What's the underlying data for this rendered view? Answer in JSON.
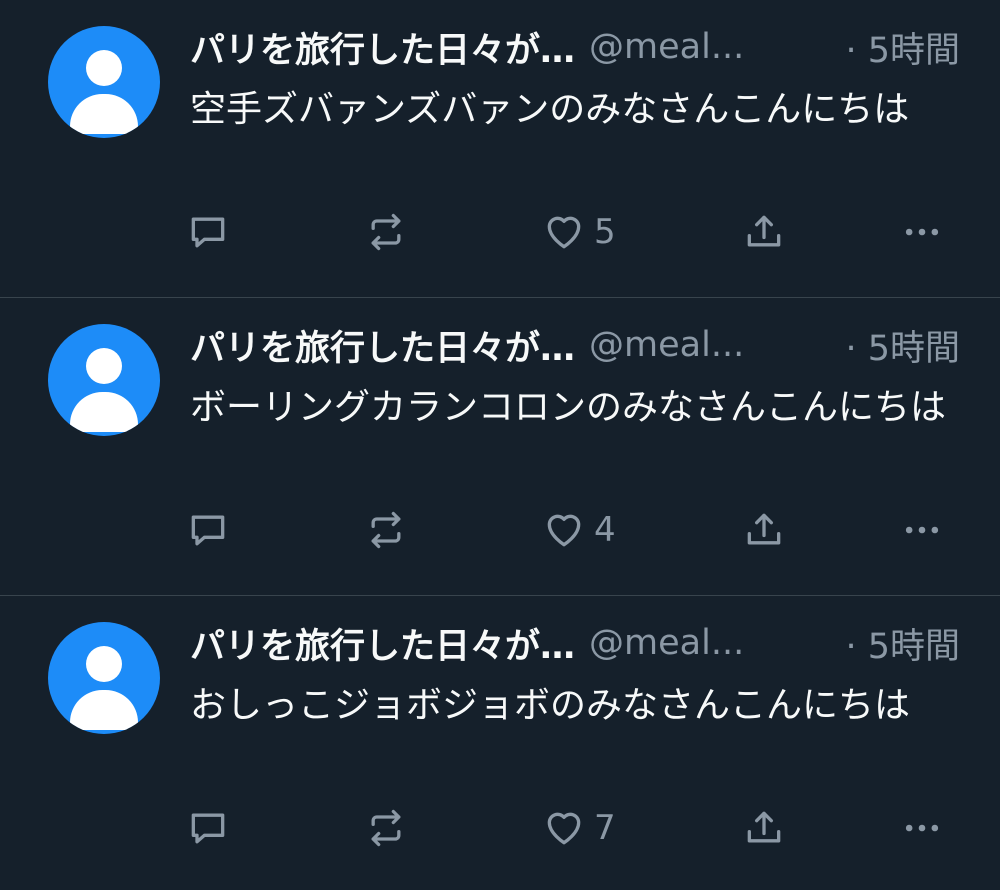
{
  "tweets": [
    {
      "name": "パリを旅行した日々が…",
      "handle": "@meal...",
      "time": "· 5時間",
      "text": "空手ズバァンズバァンのみなさんこんにちは",
      "likes": "5"
    },
    {
      "name": "パリを旅行した日々が…",
      "handle": "@meal...",
      "time": "· 5時間",
      "text": "ボーリングカランコロンのみなさんこんにちは",
      "likes": "4"
    },
    {
      "name": "パリを旅行した日々が…",
      "handle": "@meal...",
      "time": "· 5時間",
      "text": "おしっこジョボジョボのみなさんこんにちは",
      "likes": "7"
    }
  ],
  "icons": {
    "reply": "reply-icon",
    "retweet": "retweet-icon",
    "like": "heart-icon",
    "share": "share-icon",
    "more": "more-icon"
  },
  "colors": {
    "background": "#15202b",
    "text": "#f7f9f9",
    "secondary": "#8b98a5",
    "avatar": "#1d8cf8",
    "divider": "#38444d"
  }
}
